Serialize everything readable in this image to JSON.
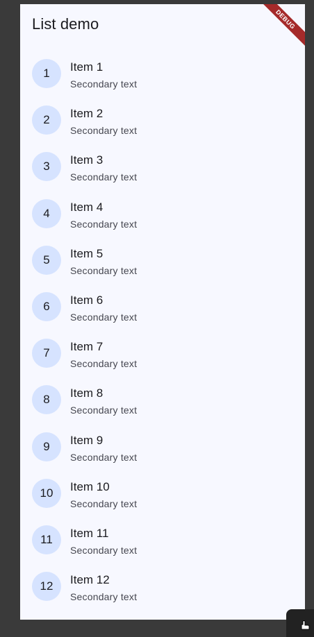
{
  "app": {
    "title": "List demo",
    "debug_label": "DEBUG"
  },
  "list": {
    "items": [
      {
        "avatar": "1",
        "title": "Item 1",
        "subtitle": "Secondary text"
      },
      {
        "avatar": "2",
        "title": "Item 2",
        "subtitle": "Secondary text"
      },
      {
        "avatar": "3",
        "title": "Item 3",
        "subtitle": "Secondary text"
      },
      {
        "avatar": "4",
        "title": "Item 4",
        "subtitle": "Secondary text"
      },
      {
        "avatar": "5",
        "title": "Item 5",
        "subtitle": "Secondary text"
      },
      {
        "avatar": "6",
        "title": "Item 6",
        "subtitle": "Secondary text"
      },
      {
        "avatar": "7",
        "title": "Item 7",
        "subtitle": "Secondary text"
      },
      {
        "avatar": "8",
        "title": "Item 8",
        "subtitle": "Secondary text"
      },
      {
        "avatar": "9",
        "title": "Item 9",
        "subtitle": "Secondary text"
      },
      {
        "avatar": "10",
        "title": "Item 10",
        "subtitle": "Secondary text"
      },
      {
        "avatar": "11",
        "title": "Item 11",
        "subtitle": "Secondary text"
      },
      {
        "avatar": "12",
        "title": "Item 12",
        "subtitle": "Secondary text"
      }
    ]
  },
  "colors": {
    "background": "#f7f8ff",
    "avatar_bg": "#d6e3ff",
    "debug_banner": "#a52a2a",
    "outer": "#3a3a3a"
  },
  "icons": {
    "cursor": "hand-pointer-icon"
  }
}
